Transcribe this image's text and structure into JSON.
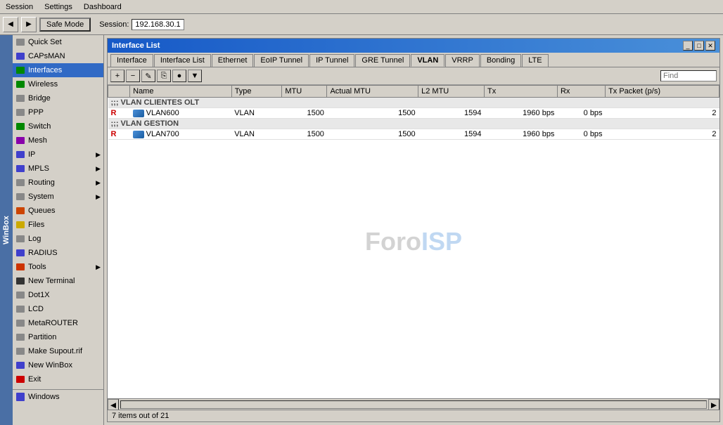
{
  "menubar": {
    "items": [
      "Session",
      "Settings",
      "Dashboard"
    ]
  },
  "toolbar": {
    "back_label": "◀",
    "forward_label": "▶",
    "safe_mode_label": "Safe Mode",
    "session_label": "Session:",
    "session_ip": "192.168.30.1"
  },
  "sidebar": {
    "items": [
      {
        "id": "quick-set",
        "label": "Quick Set",
        "icon": "quick",
        "arrow": false
      },
      {
        "id": "capsman",
        "label": "CAPsMAN",
        "icon": "capsMan",
        "arrow": false
      },
      {
        "id": "interfaces",
        "label": "Interfaces",
        "icon": "interfaces",
        "arrow": false,
        "active": true
      },
      {
        "id": "wireless",
        "label": "Wireless",
        "icon": "wireless",
        "arrow": false
      },
      {
        "id": "bridge",
        "label": "Bridge",
        "icon": "bridge",
        "arrow": false
      },
      {
        "id": "ppp",
        "label": "PPP",
        "icon": "ppp",
        "arrow": false
      },
      {
        "id": "switch",
        "label": "Switch",
        "icon": "switch",
        "arrow": false
      },
      {
        "id": "mesh",
        "label": "Mesh",
        "icon": "mesh",
        "arrow": false
      },
      {
        "id": "ip",
        "label": "IP",
        "icon": "ip",
        "arrow": true
      },
      {
        "id": "mpls",
        "label": "MPLS",
        "icon": "mpls",
        "arrow": true
      },
      {
        "id": "routing",
        "label": "Routing",
        "icon": "routing",
        "arrow": true
      },
      {
        "id": "system",
        "label": "System",
        "icon": "system",
        "arrow": true
      },
      {
        "id": "queues",
        "label": "Queues",
        "icon": "queues",
        "arrow": false
      },
      {
        "id": "files",
        "label": "Files",
        "icon": "files",
        "arrow": false
      },
      {
        "id": "log",
        "label": "Log",
        "icon": "log",
        "arrow": false
      },
      {
        "id": "radius",
        "label": "RADIUS",
        "icon": "radius",
        "arrow": false
      },
      {
        "id": "tools",
        "label": "Tools",
        "icon": "tools",
        "arrow": true
      },
      {
        "id": "new-terminal",
        "label": "New Terminal",
        "icon": "terminal",
        "arrow": false
      },
      {
        "id": "dot1x",
        "label": "Dot1X",
        "icon": "dot1x",
        "arrow": false
      },
      {
        "id": "lcd",
        "label": "LCD",
        "icon": "lcd",
        "arrow": false
      },
      {
        "id": "metarouter",
        "label": "MetaROUTER",
        "icon": "metarouter",
        "arrow": false
      },
      {
        "id": "partition",
        "label": "Partition",
        "icon": "partition",
        "arrow": false
      },
      {
        "id": "make-supout",
        "label": "Make Supout.rif",
        "icon": "make",
        "arrow": false
      },
      {
        "id": "new-winbox",
        "label": "New WinBox",
        "icon": "newwin",
        "arrow": false
      },
      {
        "id": "exit",
        "label": "Exit",
        "icon": "exit",
        "arrow": false
      }
    ],
    "windows_label": "Windows"
  },
  "window": {
    "title": "Interface List",
    "tabs": [
      {
        "id": "interface",
        "label": "Interface"
      },
      {
        "id": "interface-list",
        "label": "Interface List"
      },
      {
        "id": "ethernet",
        "label": "Ethernet"
      },
      {
        "id": "eoip-tunnel",
        "label": "EoIP Tunnel"
      },
      {
        "id": "ip-tunnel",
        "label": "IP Tunnel"
      },
      {
        "id": "gre-tunnel",
        "label": "GRE Tunnel"
      },
      {
        "id": "vlan",
        "label": "VLAN",
        "active": true
      },
      {
        "id": "vrrp",
        "label": "VRRP"
      },
      {
        "id": "bonding",
        "label": "Bonding"
      },
      {
        "id": "lte",
        "label": "LTE"
      }
    ],
    "toolbar": {
      "add": "+",
      "remove": "−",
      "edit": "✎",
      "copy": "⎘",
      "disable": "●",
      "filter": "▼",
      "find_placeholder": "Find"
    },
    "table": {
      "columns": [
        "",
        "Name",
        "Type",
        "MTU",
        "Actual MTU",
        "L2 MTU",
        "Tx",
        "Rx",
        "Tx Packet (p/s)"
      ],
      "groups": [
        {
          "label": ";;; VLAN CLIENTES OLT",
          "rows": [
            {
              "flag": "R",
              "name": "VLAN600",
              "type": "VLAN",
              "mtu": "1500",
              "actual_mtu": "1500",
              "l2_mtu": "1594",
              "tx": "1960 bps",
              "rx": "0 bps",
              "tx_packet": "2"
            }
          ]
        },
        {
          "label": ";;; VLAN GESTION",
          "rows": [
            {
              "flag": "R",
              "name": "VLAN700",
              "type": "VLAN",
              "mtu": "1500",
              "actual_mtu": "1500",
              "l2_mtu": "1594",
              "tx": "1960 bps",
              "rx": "0 bps",
              "tx_packet": "2"
            }
          ]
        }
      ]
    },
    "watermark": "ForoISP",
    "status": "7 items out of 21"
  },
  "winbox_label": "WinBox",
  "windows_bar": {
    "label": "Windows"
  }
}
